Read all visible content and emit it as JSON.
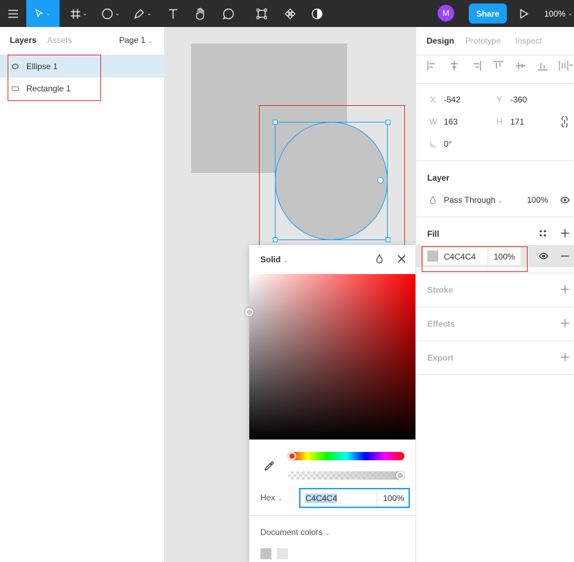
{
  "toolbar": {
    "avatar_initial": "M",
    "share_label": "Share",
    "zoom_label": "100%"
  },
  "left_panel": {
    "tabs": [
      "Layers",
      "Assets"
    ],
    "page_label": "Page 1",
    "layers": [
      {
        "name": "Ellipse 1"
      },
      {
        "name": "Rectangle 1"
      }
    ]
  },
  "color_picker": {
    "fill_type": "Solid",
    "color_model": "Hex",
    "hex_value": "C4C4C4",
    "opacity": "100%",
    "document_colors_label": "Document colors",
    "document_colors": [
      "#c4c4c4",
      "#e5e5e5"
    ]
  },
  "right_panel": {
    "tabs": [
      "Design",
      "Prototype",
      "Inspect"
    ],
    "x_label": "X",
    "x_value": "-542",
    "y_label": "Y",
    "y_value": "-360",
    "w_label": "W",
    "w_value": "163",
    "h_label": "H",
    "h_value": "171",
    "rotation_value": "0°",
    "layer_title": "Layer",
    "blend_mode": "Pass Through",
    "layer_opacity": "100%",
    "fill_title": "Fill",
    "fill_hex": "C4C4C4",
    "fill_opacity": "100%",
    "fill_color": "#c4c4c4",
    "stroke_title": "Stroke",
    "effects_title": "Effects",
    "export_title": "Export"
  },
  "colors": {
    "accent": "#18a0fb",
    "toolbar_bg": "#2c2c2c",
    "avatar": "#9747ff",
    "annotation_red": "#e02a2a"
  }
}
